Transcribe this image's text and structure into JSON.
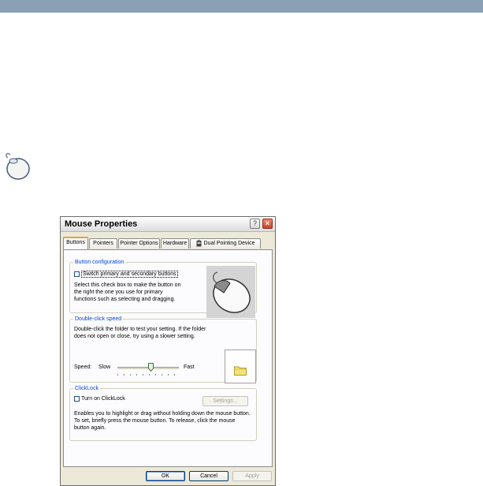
{
  "dialog": {
    "title": "Mouse Properties",
    "help_glyph": "?",
    "close_glyph": "×",
    "tabs": [
      {
        "label": "Buttons",
        "active": true
      },
      {
        "label": "Pointers"
      },
      {
        "label": "Pointer Options"
      },
      {
        "label": "Hardware"
      },
      {
        "label": "Dual Pointing Device",
        "icon": "device-icon"
      }
    ],
    "button_configuration": {
      "legend": "Button configuration",
      "checkbox_label": "Switch primary and secondary buttons",
      "checked": false,
      "description": "Select this check box to make the button on the right the one you use for primary functions such as selecting and dragging."
    },
    "double_click": {
      "legend": "Double-click speed",
      "description": "Double-click the folder to test your setting. If the folder does not open or close, try using a slower setting.",
      "speed_label": "Speed:",
      "slow_label": "Slow",
      "fast_label": "Fast",
      "slider_level": 0.55
    },
    "clicklock": {
      "legend": "ClickLock",
      "checkbox_label": "Turn on ClickLock",
      "checked": false,
      "settings_label": "Settings...",
      "description": "Enables you to highlight or drag without holding down the mouse button. To set, briefly press the mouse button. To release, click the mouse button again."
    },
    "buttons": {
      "ok": "OK",
      "cancel": "Cancel",
      "apply": "Apply"
    }
  },
  "icons": {
    "page_icon": "mouse-icon",
    "preview": "mouse-preview-icon",
    "folder": "folder-icon"
  },
  "colors": {
    "title_accent": "#0046d5",
    "tab_highlight": "#e4a032",
    "topbar": "#8aa0b4",
    "close_button": "#c9402a"
  }
}
